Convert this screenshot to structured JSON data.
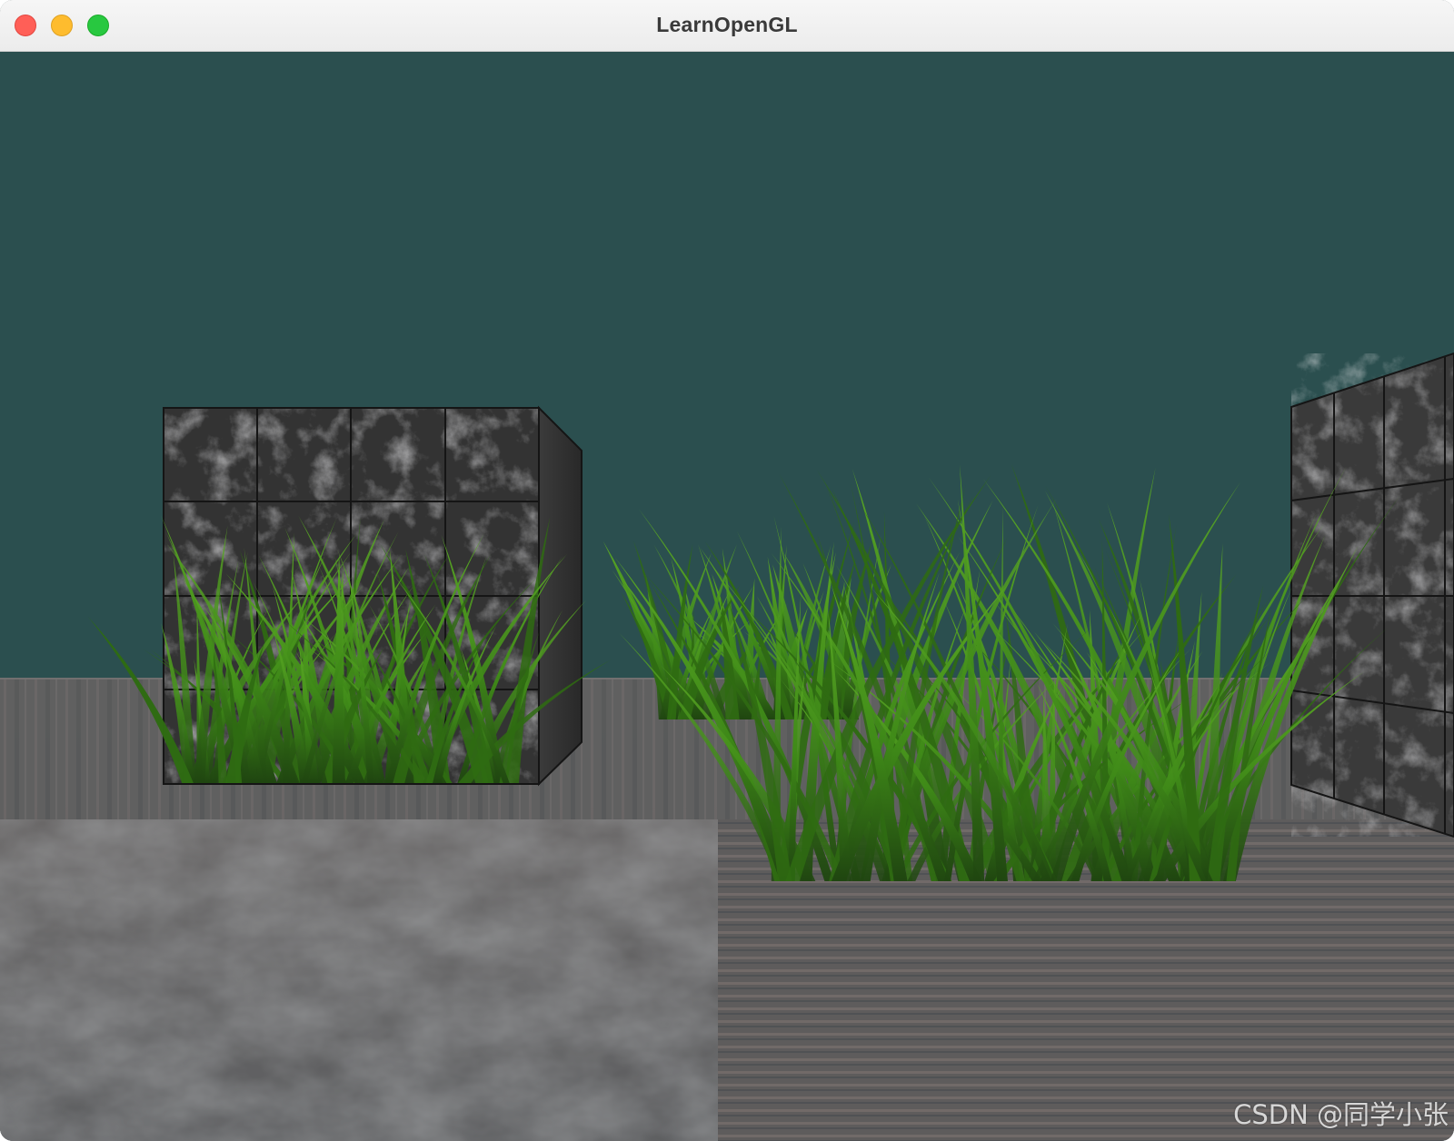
{
  "window": {
    "title": "LearnOpenGL",
    "clear_color": "#2b4f4f"
  },
  "title_buttons": {
    "close": "close",
    "minimize": "minimize",
    "zoom": "zoom"
  },
  "scene": {
    "objects": [
      "marble-cube",
      "marble-cube-right",
      "grass-left",
      "grass-center",
      "grass-right",
      "floor"
    ]
  },
  "watermark": "CSDN @同学小张"
}
